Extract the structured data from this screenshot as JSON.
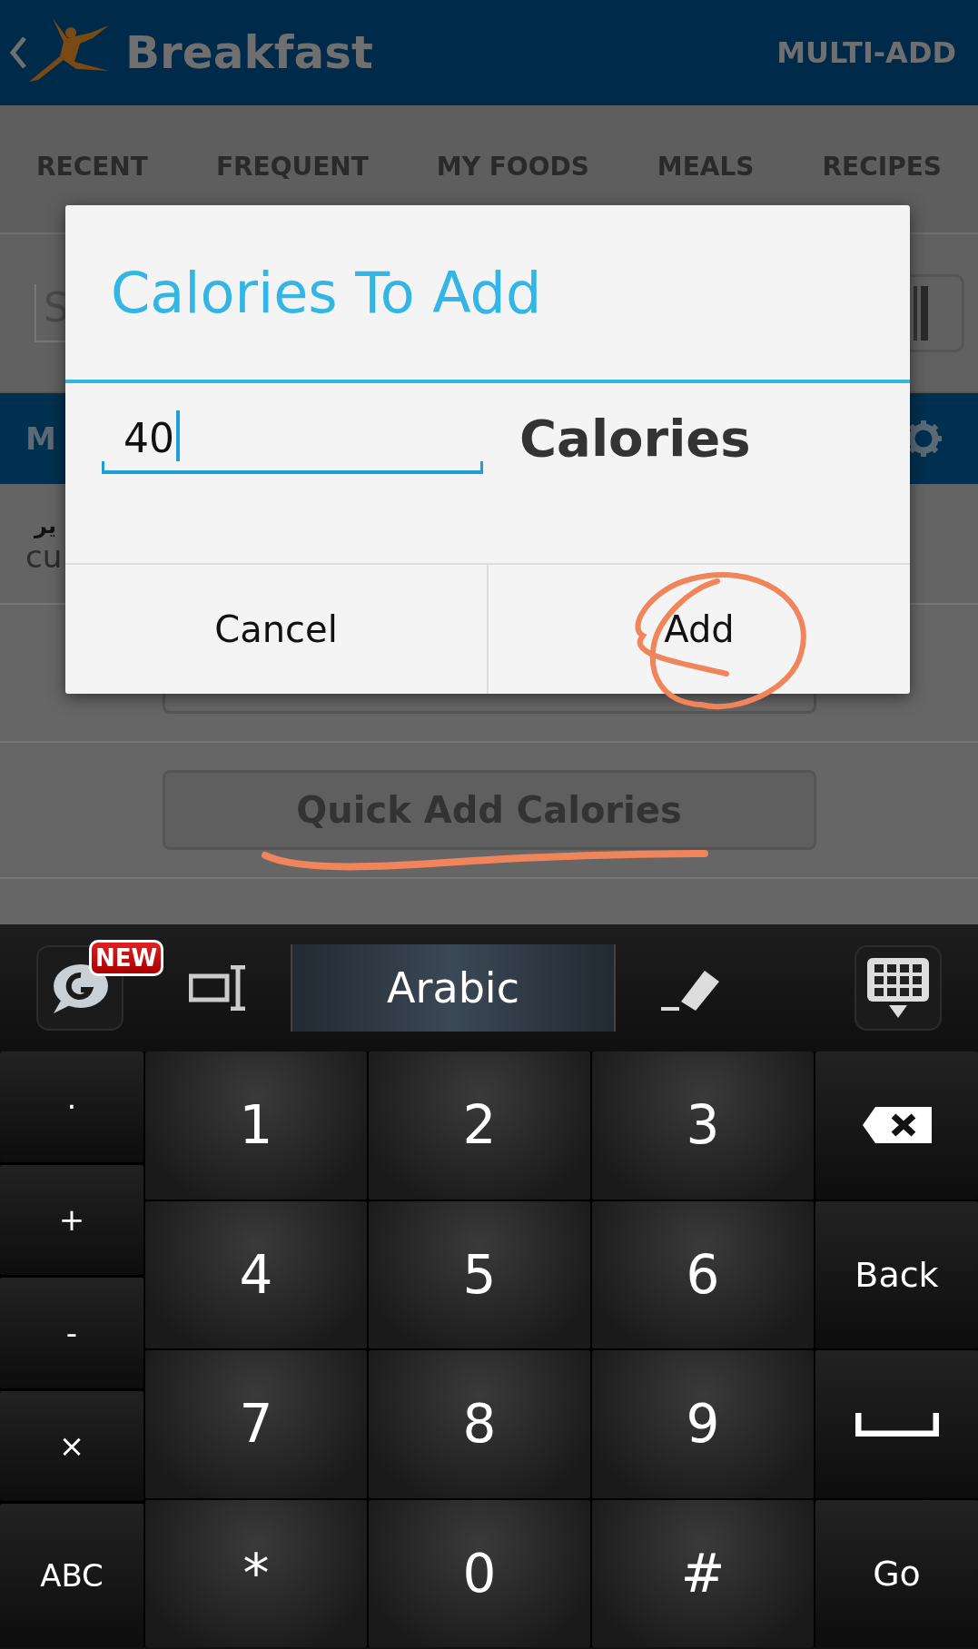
{
  "header": {
    "title": "Breakfast",
    "action": "MULTI-ADD"
  },
  "tabs": [
    {
      "label": "RECENT",
      "selected": false
    },
    {
      "label": "FREQUENT",
      "selected": false
    },
    {
      "label": "MY FOODS",
      "selected": false
    },
    {
      "label": "MEALS",
      "selected": false
    },
    {
      "label": "RECIPES",
      "selected": false
    }
  ],
  "search": {
    "placeholder": "S"
  },
  "section": {
    "title": "M"
  },
  "food_item": {
    "name": "ير",
    "detail": "cu"
  },
  "quick_add": "Quick Add Calories",
  "dialog": {
    "title": "Calories To Add",
    "field": {
      "value": "40"
    },
    "unit": "Calories",
    "buttons": [
      {
        "label": "Cancel"
      },
      {
        "label": "Add"
      }
    ]
  },
  "keyboard": {
    "badge": "NEW",
    "language": "Arabic",
    "side_keys": [
      "·",
      "+",
      "-",
      "×",
      "ABC"
    ],
    "keys": [
      [
        "1",
        "2",
        "3"
      ],
      [
        "4",
        "5",
        "6"
      ],
      [
        "7",
        "8",
        "9"
      ],
      [
        "*",
        "0",
        "#"
      ]
    ],
    "right_keys": [
      {
        "kind": "backspace"
      },
      {
        "kind": "text",
        "label": "Back"
      },
      {
        "kind": "space"
      },
      {
        "kind": "text",
        "label": "Go"
      }
    ]
  }
}
